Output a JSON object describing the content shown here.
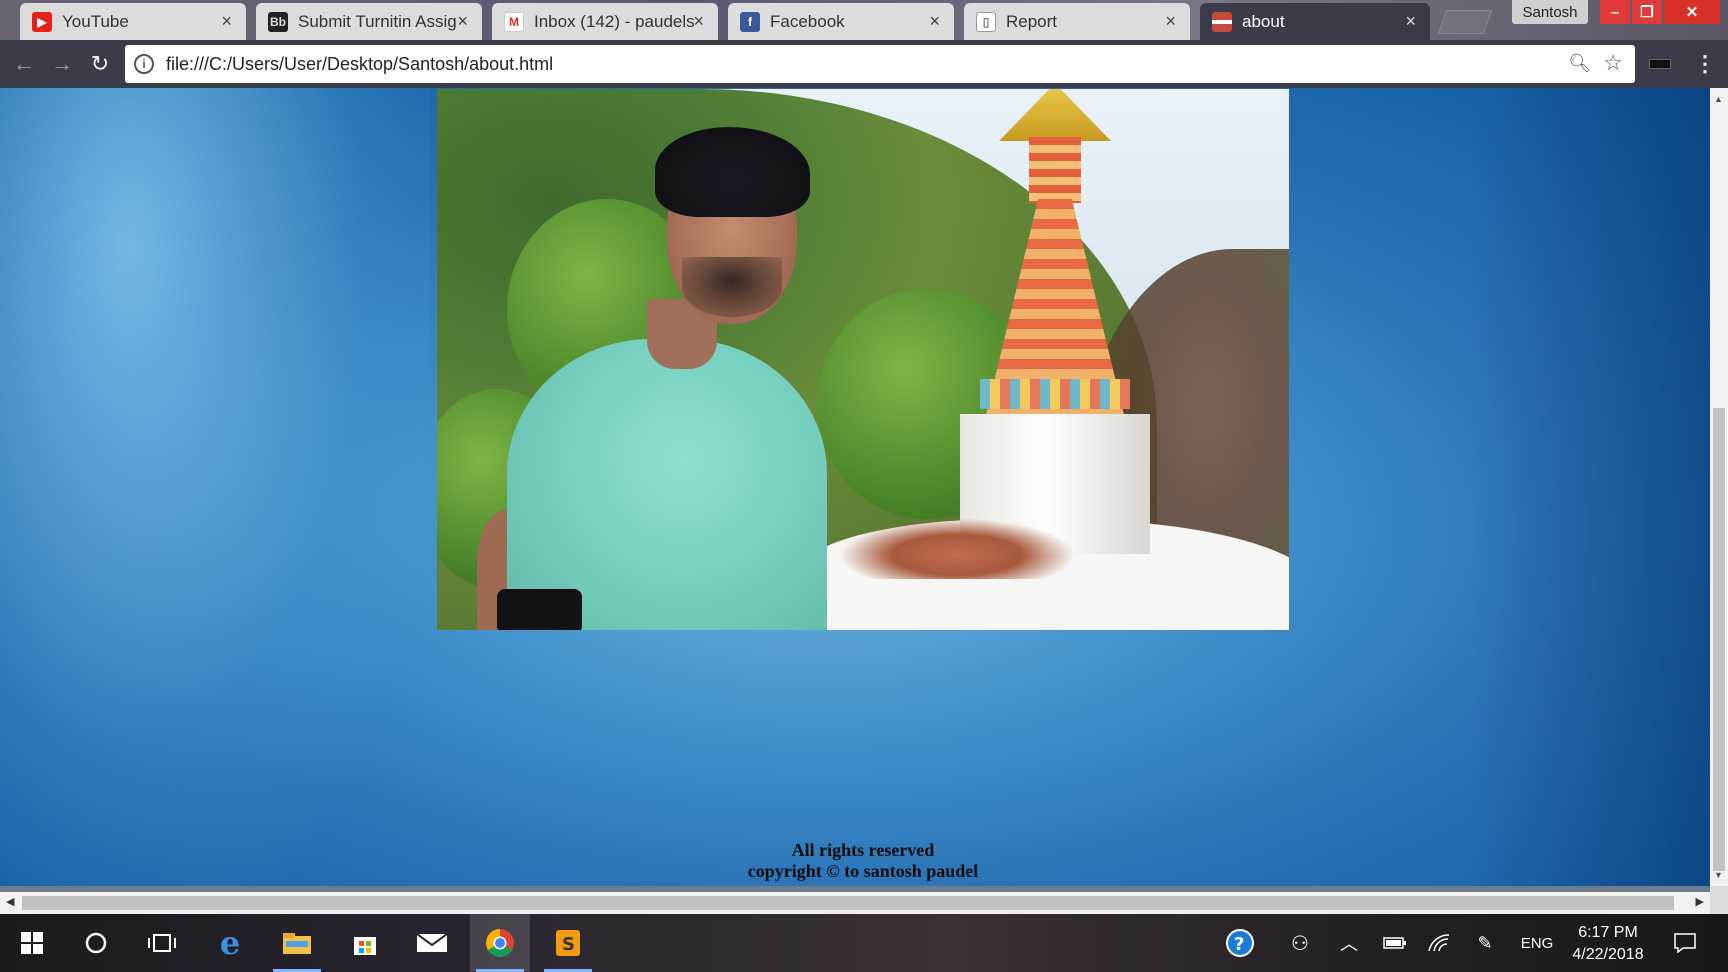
{
  "browser": {
    "tabs": [
      {
        "label": "YouTube",
        "favicon": "youtube-icon",
        "active": false
      },
      {
        "label": "Submit Turnitin Assig",
        "favicon": "blackboard-icon",
        "active": false
      },
      {
        "label": "Inbox (142) - paudels",
        "favicon": "gmail-icon",
        "active": false
      },
      {
        "label": "Facebook",
        "favicon": "facebook-icon",
        "active": false
      },
      {
        "label": "Report",
        "favicon": "document-icon",
        "active": false
      },
      {
        "label": "about",
        "favicon": "page-icon",
        "active": true
      }
    ],
    "profile_name": "Santosh",
    "url": "file:///C:/Users/User/Desktop/Santosh/about.html"
  },
  "page": {
    "photo": {
      "icon": "portrait-photo",
      "subject": "person-near-stupa"
    },
    "footer": {
      "line1": "All rights reserved",
      "line2": "copyright © to santosh paudel"
    }
  },
  "taskbar": {
    "apps": [
      "windows-start-icon",
      "cortana-icon",
      "task-view-icon",
      "edge-icon",
      "file-explorer-icon",
      "store-icon",
      "mail-icon",
      "chrome-icon",
      "sublime-text-icon"
    ],
    "active_apps": [
      "chrome-icon",
      "sublime-text-icon"
    ],
    "language": "ENG",
    "time": "6:17 PM",
    "date": "4/22/2018"
  },
  "colors": {
    "page_background": "#2a73b6",
    "toolbar": "#3b3b4a",
    "close_button": "#d9302a"
  }
}
